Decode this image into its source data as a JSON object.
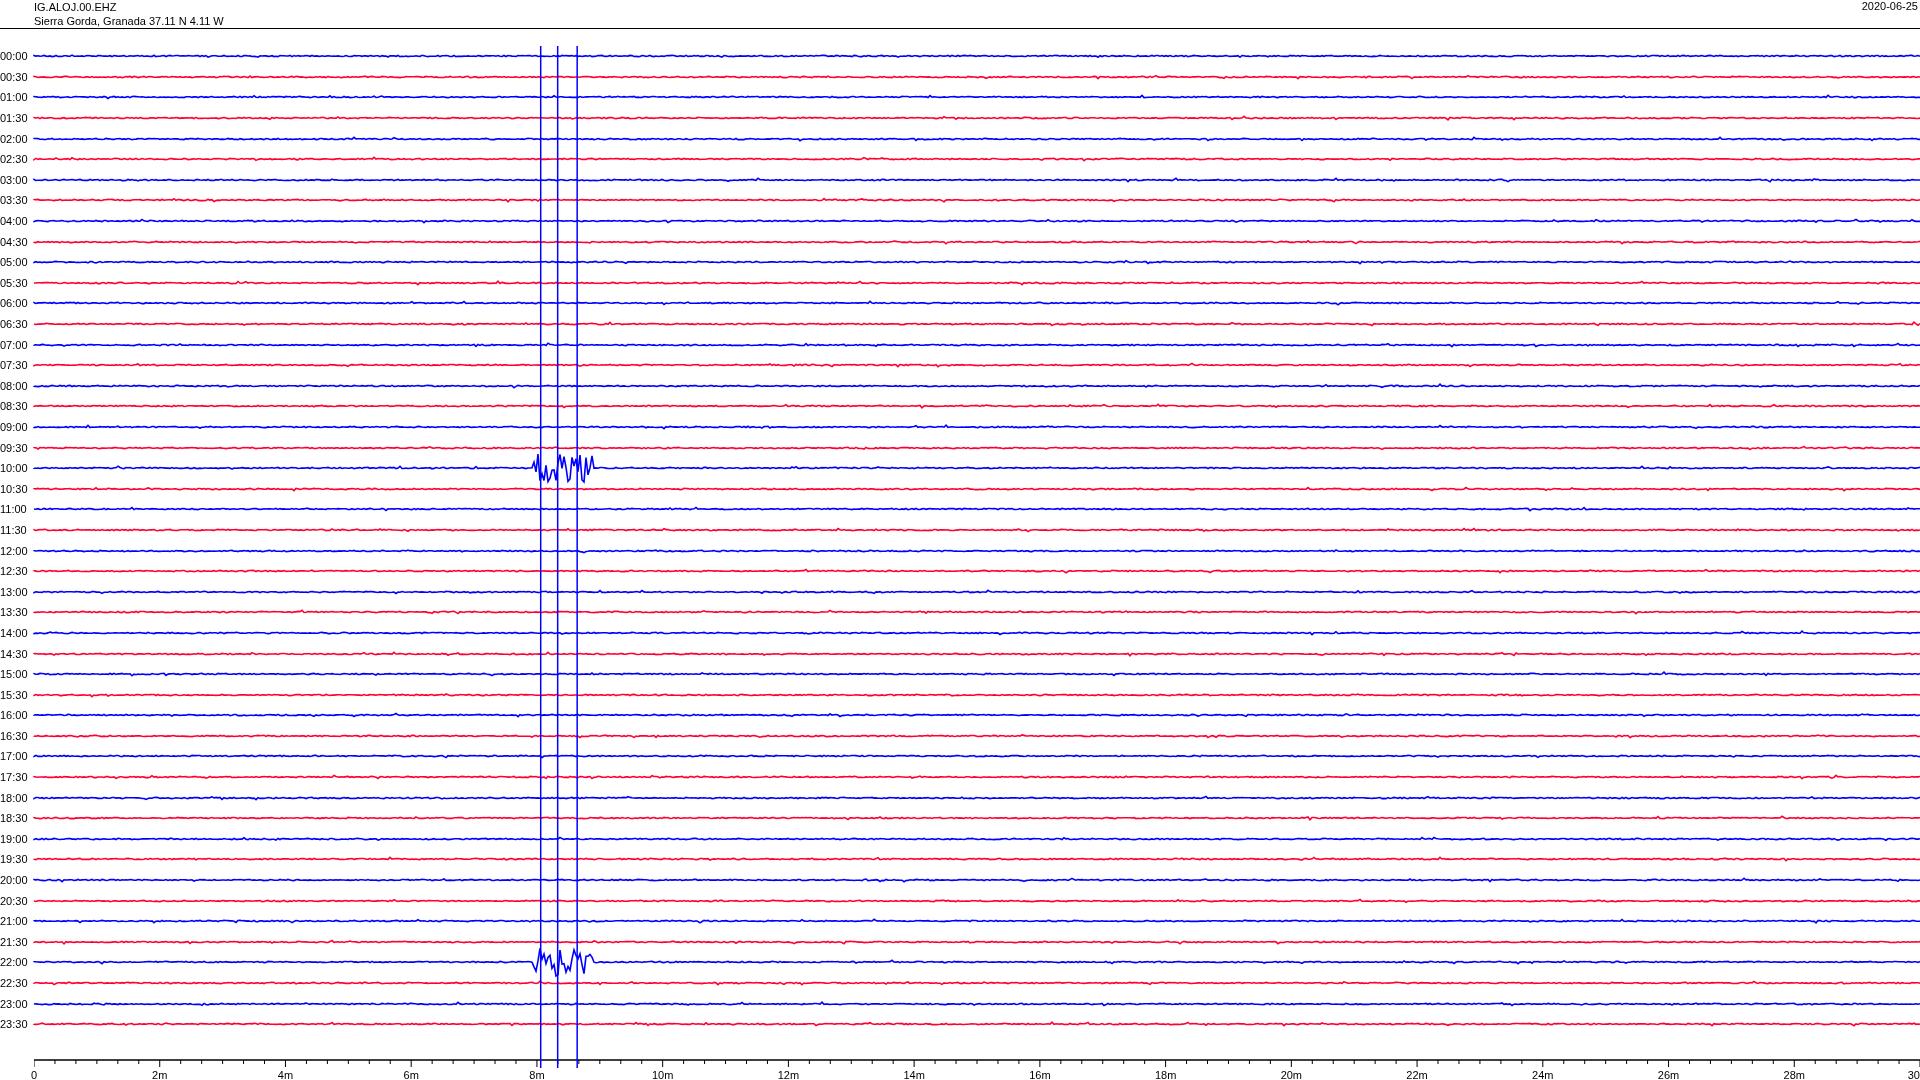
{
  "header": {
    "station": "IG.ALOJ.00.EHZ",
    "location": "Sierra Gorda, Granada  37.11 N 4.11 W",
    "date": "2020-06-25"
  },
  "rows": [
    {
      "time": "00:00",
      "color": "#0000ff",
      "event": false
    },
    {
      "time": "00:30",
      "color": "#ff0033",
      "event": false
    },
    {
      "time": "01:00",
      "color": "#0000ff",
      "event": false
    },
    {
      "time": "01:30",
      "color": "#ff0033",
      "event": false
    },
    {
      "time": "02:00",
      "color": "#0000ff",
      "event": false
    },
    {
      "time": "02:30",
      "color": "#ff0033",
      "event": false
    },
    {
      "time": "03:00",
      "color": "#0000ff",
      "event": false
    },
    {
      "time": "03:30",
      "color": "#ff0033",
      "event": false
    },
    {
      "time": "04:00",
      "color": "#0000ff",
      "event": false
    },
    {
      "time": "04:30",
      "color": "#ff0033",
      "event": false
    },
    {
      "time": "05:00",
      "color": "#0000ff",
      "event": false
    },
    {
      "time": "05:30",
      "color": "#ff0033",
      "event": false
    },
    {
      "time": "06:00",
      "color": "#0000ff",
      "event": false
    },
    {
      "time": "06:30",
      "color": "#ff0033",
      "event": false
    },
    {
      "time": "07:00",
      "color": "#0000ff",
      "event": false
    },
    {
      "time": "07:30",
      "color": "#ff0033",
      "event": false
    },
    {
      "time": "08:00",
      "color": "#0000ff",
      "event": false
    },
    {
      "time": "08:30",
      "color": "#ff0033",
      "event": false
    },
    {
      "time": "09:00",
      "color": "#0000ff",
      "event": false
    },
    {
      "time": "09:30",
      "color": "#ff0033",
      "event": false
    },
    {
      "time": "10:00",
      "color": "#0000ff",
      "event": true
    },
    {
      "time": "10:30",
      "color": "#ff0033",
      "event": false
    },
    {
      "time": "11:00",
      "color": "#0000ff",
      "event": false
    },
    {
      "time": "11:30",
      "color": "#ff0033",
      "event": false
    },
    {
      "time": "12:00",
      "color": "#0000ff",
      "event": false
    },
    {
      "time": "12:30",
      "color": "#ff0033",
      "event": false
    },
    {
      "time": "13:00",
      "color": "#0000ff",
      "event": false
    },
    {
      "time": "13:30",
      "color": "#ff0033",
      "event": false
    },
    {
      "time": "14:00",
      "color": "#0000ff",
      "event": false
    },
    {
      "time": "14:30",
      "color": "#ff0033",
      "event": false
    },
    {
      "time": "15:00",
      "color": "#0000ff",
      "event": false
    },
    {
      "time": "15:30",
      "color": "#ff0033",
      "event": false
    },
    {
      "time": "16:00",
      "color": "#0000ff",
      "event": false
    },
    {
      "time": "16:30",
      "color": "#ff0033",
      "event": false
    },
    {
      "time": "17:00",
      "color": "#0000ff",
      "event": false
    },
    {
      "time": "17:30",
      "color": "#ff0033",
      "event": false
    },
    {
      "time": "18:00",
      "color": "#0000ff",
      "event": false
    },
    {
      "time": "18:30",
      "color": "#ff0033",
      "event": false
    },
    {
      "time": "19:00",
      "color": "#0000ff",
      "event": false
    },
    {
      "time": "19:30",
      "color": "#ff0033",
      "event": false
    },
    {
      "time": "20:00",
      "color": "#0000ff",
      "event": false
    },
    {
      "time": "20:30",
      "color": "#ff0033",
      "event": false
    },
    {
      "time": "21:00",
      "color": "#0000ff",
      "event": false
    },
    {
      "time": "21:30",
      "color": "#ff0033",
      "event": false
    },
    {
      "time": "22:00",
      "color": "#0000ff",
      "event": true
    },
    {
      "time": "22:30",
      "color": "#ff0033",
      "event": false
    },
    {
      "time": "23:00",
      "color": "#0000ff",
      "event": false
    },
    {
      "time": "23:30",
      "color": "#ff0033",
      "event": false
    }
  ],
  "x_axis": {
    "labels": [
      "0",
      "2m",
      "4m",
      "6m",
      "8m",
      "10m",
      "12m",
      "14m",
      "16m",
      "18m",
      "20m",
      "22m",
      "24m",
      "26m",
      "28m",
      "30"
    ]
  }
}
